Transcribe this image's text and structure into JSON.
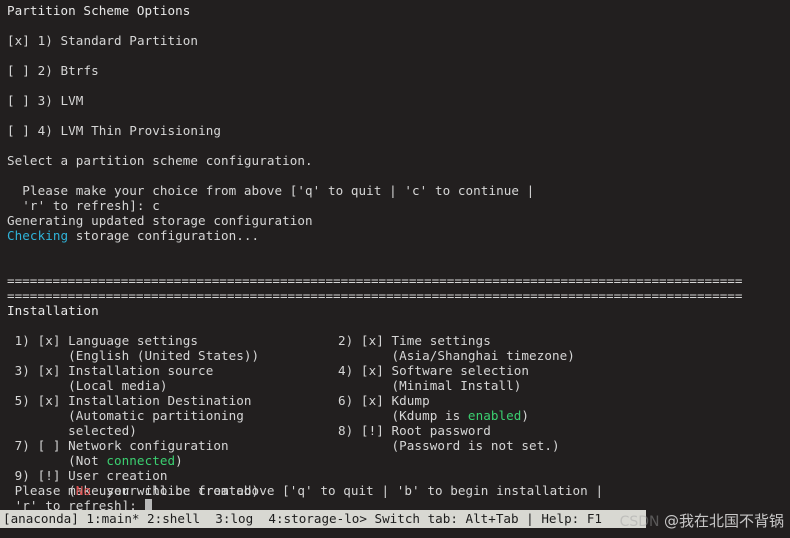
{
  "terminal": {
    "partition_dialog": {
      "title": "Partition Scheme Options",
      "options": [
        {
          "mark": "[x]",
          "text": "1) Standard Partition"
        },
        {
          "mark": "[ ]",
          "text": "2) Btrfs"
        },
        {
          "mark": "[ ]",
          "text": "3) LVM"
        },
        {
          "mark": "[ ]",
          "text": "4) LVM Thin Provisioning"
        }
      ],
      "instruction": "Select a partition scheme configuration.",
      "prompt_line1": "  Please make your choice from above ['q' to quit | 'c' to continue |",
      "prompt_line2": "  'r' to refresh]: c"
    },
    "log_lines": [
      {
        "text": "Generating updated storage configuration",
        "color": "default"
      },
      {
        "prefix": "Checking",
        "prefix_color": "cyan",
        "suffix": " storage configuration..."
      }
    ],
    "separator": "=================================================================================================",
    "section_title": "Installation",
    "install_menu": {
      "left_column": [
        {
          "line": " 1) [x] Language settings"
        },
        {
          "line": "        (English (United States))"
        },
        {
          "line": " 3) [x] Installation source"
        },
        {
          "line": "        (Local media)"
        },
        {
          "line": " 5) [x] Installation Destination"
        },
        {
          "line": "        (Automatic partitioning"
        },
        {
          "line": "        selected)"
        },
        {
          "line": " 7) [ ] Network configuration"
        },
        {
          "pre": "        (Not ",
          "hl": "connected",
          "hl_color": "green",
          "post": ")"
        },
        {
          "line": " 9) [!] User creation"
        },
        {
          "pre": "        (",
          "hl": "No",
          "hl_color": "red",
          "post": " user will be created)"
        }
      ],
      "right_column": [
        {
          "line": "2) [x] Time settings"
        },
        {
          "line": "       (Asia/Shanghai timezone)"
        },
        {
          "line": "4) [x] Software selection"
        },
        {
          "line": "       (Minimal Install)"
        },
        {
          "line": "6) [x] Kdump"
        },
        {
          "pre": "       (Kdump is ",
          "hl": "enabled",
          "hl_color": "green",
          "post": ")"
        },
        {
          "line": "8) [!] Root password"
        },
        {
          "line": "       (Password is not set.)"
        }
      ]
    },
    "final_prompt_line1": " Please make your choice from above ['q' to quit | 'b' to begin installation |",
    "final_prompt_line2": " 'r' to refresh]: "
  },
  "statusbar": {
    "text": "[anaconda] 1:main* 2:shell  3:log  4:storage-lo> Switch tab: Alt+Tab | Help: F1"
  },
  "watermark": {
    "brand": "CSDN ",
    "handle": "@我在北国不背锅"
  },
  "colors": {
    "background": "#221f1f",
    "foreground": "#d6d6d6",
    "cyan": "#2fb3d9",
    "green": "#3bcf70",
    "red": "#e04f4f",
    "statusbar_bg": "#d8d8d2",
    "statusbar_fg": "#1c1c1c"
  }
}
